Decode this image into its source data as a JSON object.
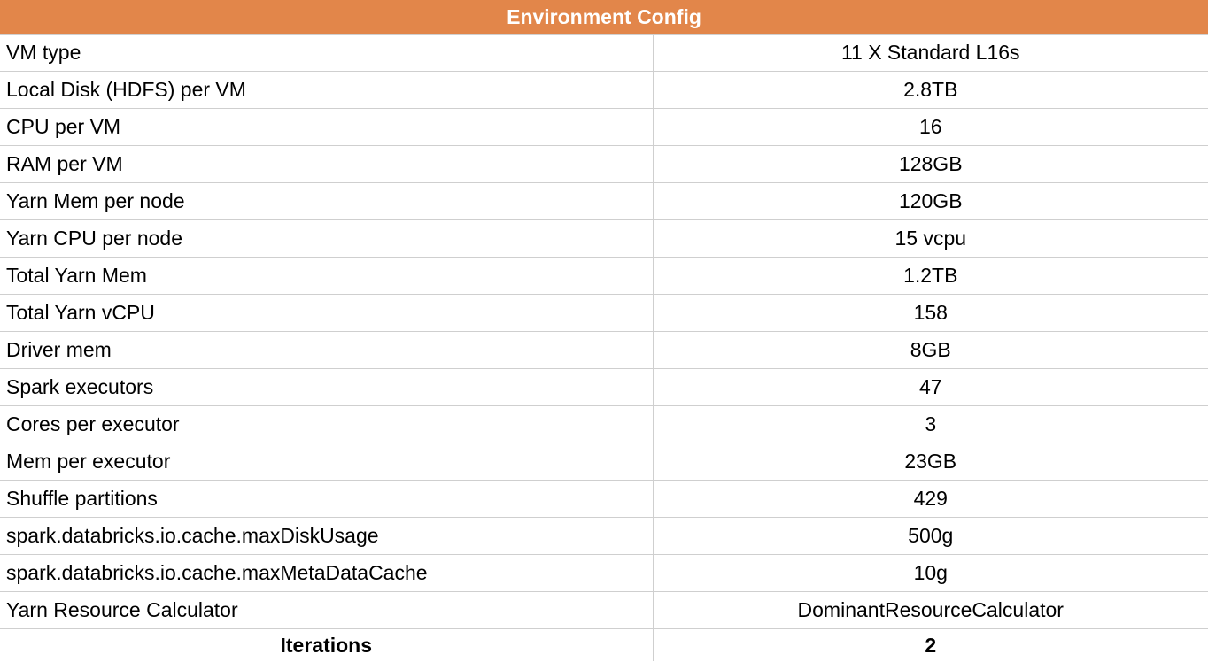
{
  "table": {
    "title": "Environment Config",
    "rows": [
      {
        "label": "VM type",
        "value": "11 X Standard L16s"
      },
      {
        "label": "Local Disk (HDFS) per VM",
        "value": "2.8TB"
      },
      {
        "label": "CPU per VM",
        "value": "16"
      },
      {
        "label": "RAM per VM",
        "value": "128GB"
      },
      {
        "label": "Yarn Mem per node",
        "value": "120GB"
      },
      {
        "label": "Yarn CPU per node",
        "value": "15 vcpu"
      },
      {
        "label": "Total Yarn Mem",
        "value": "1.2TB"
      },
      {
        "label": "Total Yarn vCPU",
        "value": "158"
      },
      {
        "label": "Driver mem",
        "value": "8GB"
      },
      {
        "label": "Spark executors",
        "value": "47"
      },
      {
        "label": "Cores per executor",
        "value": "3"
      },
      {
        "label": "Mem per executor",
        "value": "23GB"
      },
      {
        "label": "Shuffle partitions",
        "value": "429"
      },
      {
        "label": "spark.databricks.io.cache.maxDiskUsage",
        "value": "500g"
      },
      {
        "label": "spark.databricks.io.cache.maxMetaDataCache",
        "value": "10g"
      },
      {
        "label": "Yarn Resource Calculator",
        "value": "DominantResourceCalculator"
      }
    ],
    "footer": {
      "label": "Iterations",
      "value": "2"
    }
  },
  "colors": {
    "header_background": "#e2864a",
    "header_text": "#ffffff",
    "grid_line": "#cfcfcf"
  }
}
